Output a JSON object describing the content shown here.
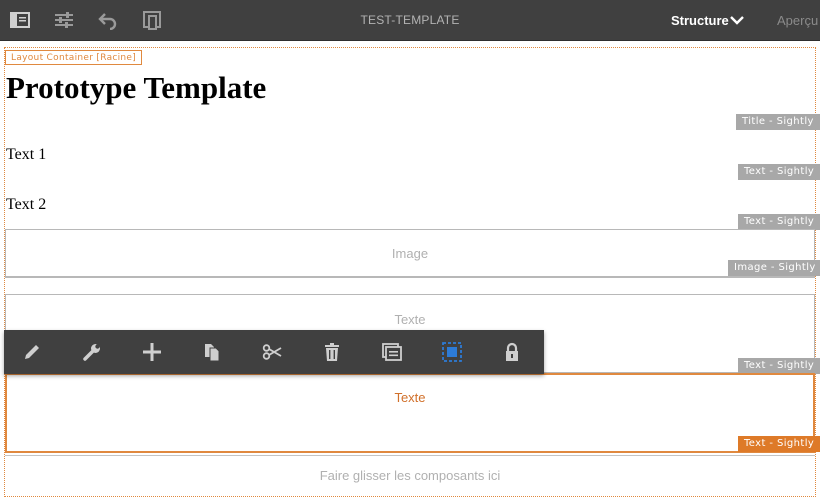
{
  "topbar": {
    "title": "TEST-TEMPLATE",
    "mode_label": "Structure",
    "preview_label": "Aperçu",
    "icons": [
      "side-panel-icon",
      "page-properties-icon",
      "undo-icon",
      "emulator-icon",
      "chevron-down-icon"
    ]
  },
  "layout": {
    "root_label": "Layout Container [Racine]"
  },
  "content": {
    "title": "Prototype Template",
    "text1": "Text 1",
    "text2": "Text 2"
  },
  "tags": {
    "title": "Title - Sightly",
    "text1": "Text - Sightly",
    "text2": "Text - Sightly",
    "image": "Image - Sightly",
    "texte1": "Text - Sightly",
    "texte2": "Text - Sightly"
  },
  "placeholders": {
    "image": "Image",
    "texte1": "Texte",
    "texte2": "Texte",
    "drop": "Faire glisser les composants ici"
  },
  "edit_toolbar": {
    "icons": [
      "edit-icon",
      "configure-icon",
      "insert-icon",
      "copy-icon",
      "cut-icon",
      "delete-icon",
      "group-icon",
      "layout-icon",
      "lock-icon"
    ]
  },
  "colors": {
    "topbar": "#404040",
    "accent_orange": "#e0893f",
    "tag_grey": "#a8a8a8",
    "active_blue": "#2d7bd6"
  }
}
